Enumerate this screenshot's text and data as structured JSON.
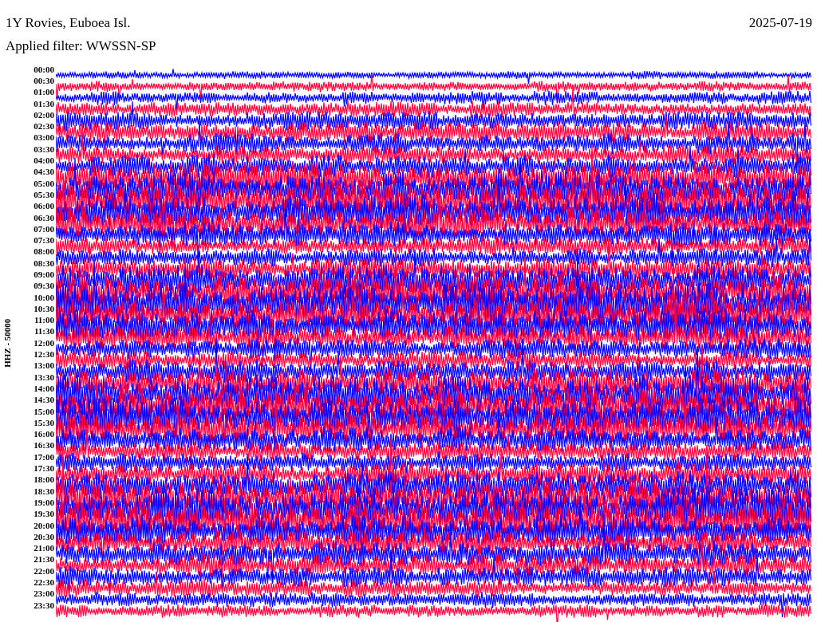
{
  "header": {
    "station": "1Y Rovies, Euboea Isl.",
    "date": "2025-07-19",
    "filter": "Applied filter: WWSSN-SP"
  },
  "axis_label": "HHZ - 50000",
  "rows": [
    "00:00",
    "00:30",
    "01:00",
    "01:30",
    "02:00",
    "02:30",
    "03:00",
    "03:30",
    "04:00",
    "04:30",
    "05:00",
    "05:30",
    "06:00",
    "06:30",
    "07:00",
    "07:30",
    "08:00",
    "08:30",
    "09:00",
    "09:30",
    "10:00",
    "10:30",
    "11:00",
    "11:30",
    "12:00",
    "12:30",
    "13:00",
    "13:30",
    "14:00",
    "14:30",
    "15:00",
    "15:30",
    "16:00",
    "16:30",
    "17:00",
    "17:30",
    "18:00",
    "18:30",
    "19:00",
    "19:30",
    "20:00",
    "20:30",
    "21:00",
    "21:30",
    "22:00",
    "22:30",
    "23:00",
    "23:30"
  ]
}
